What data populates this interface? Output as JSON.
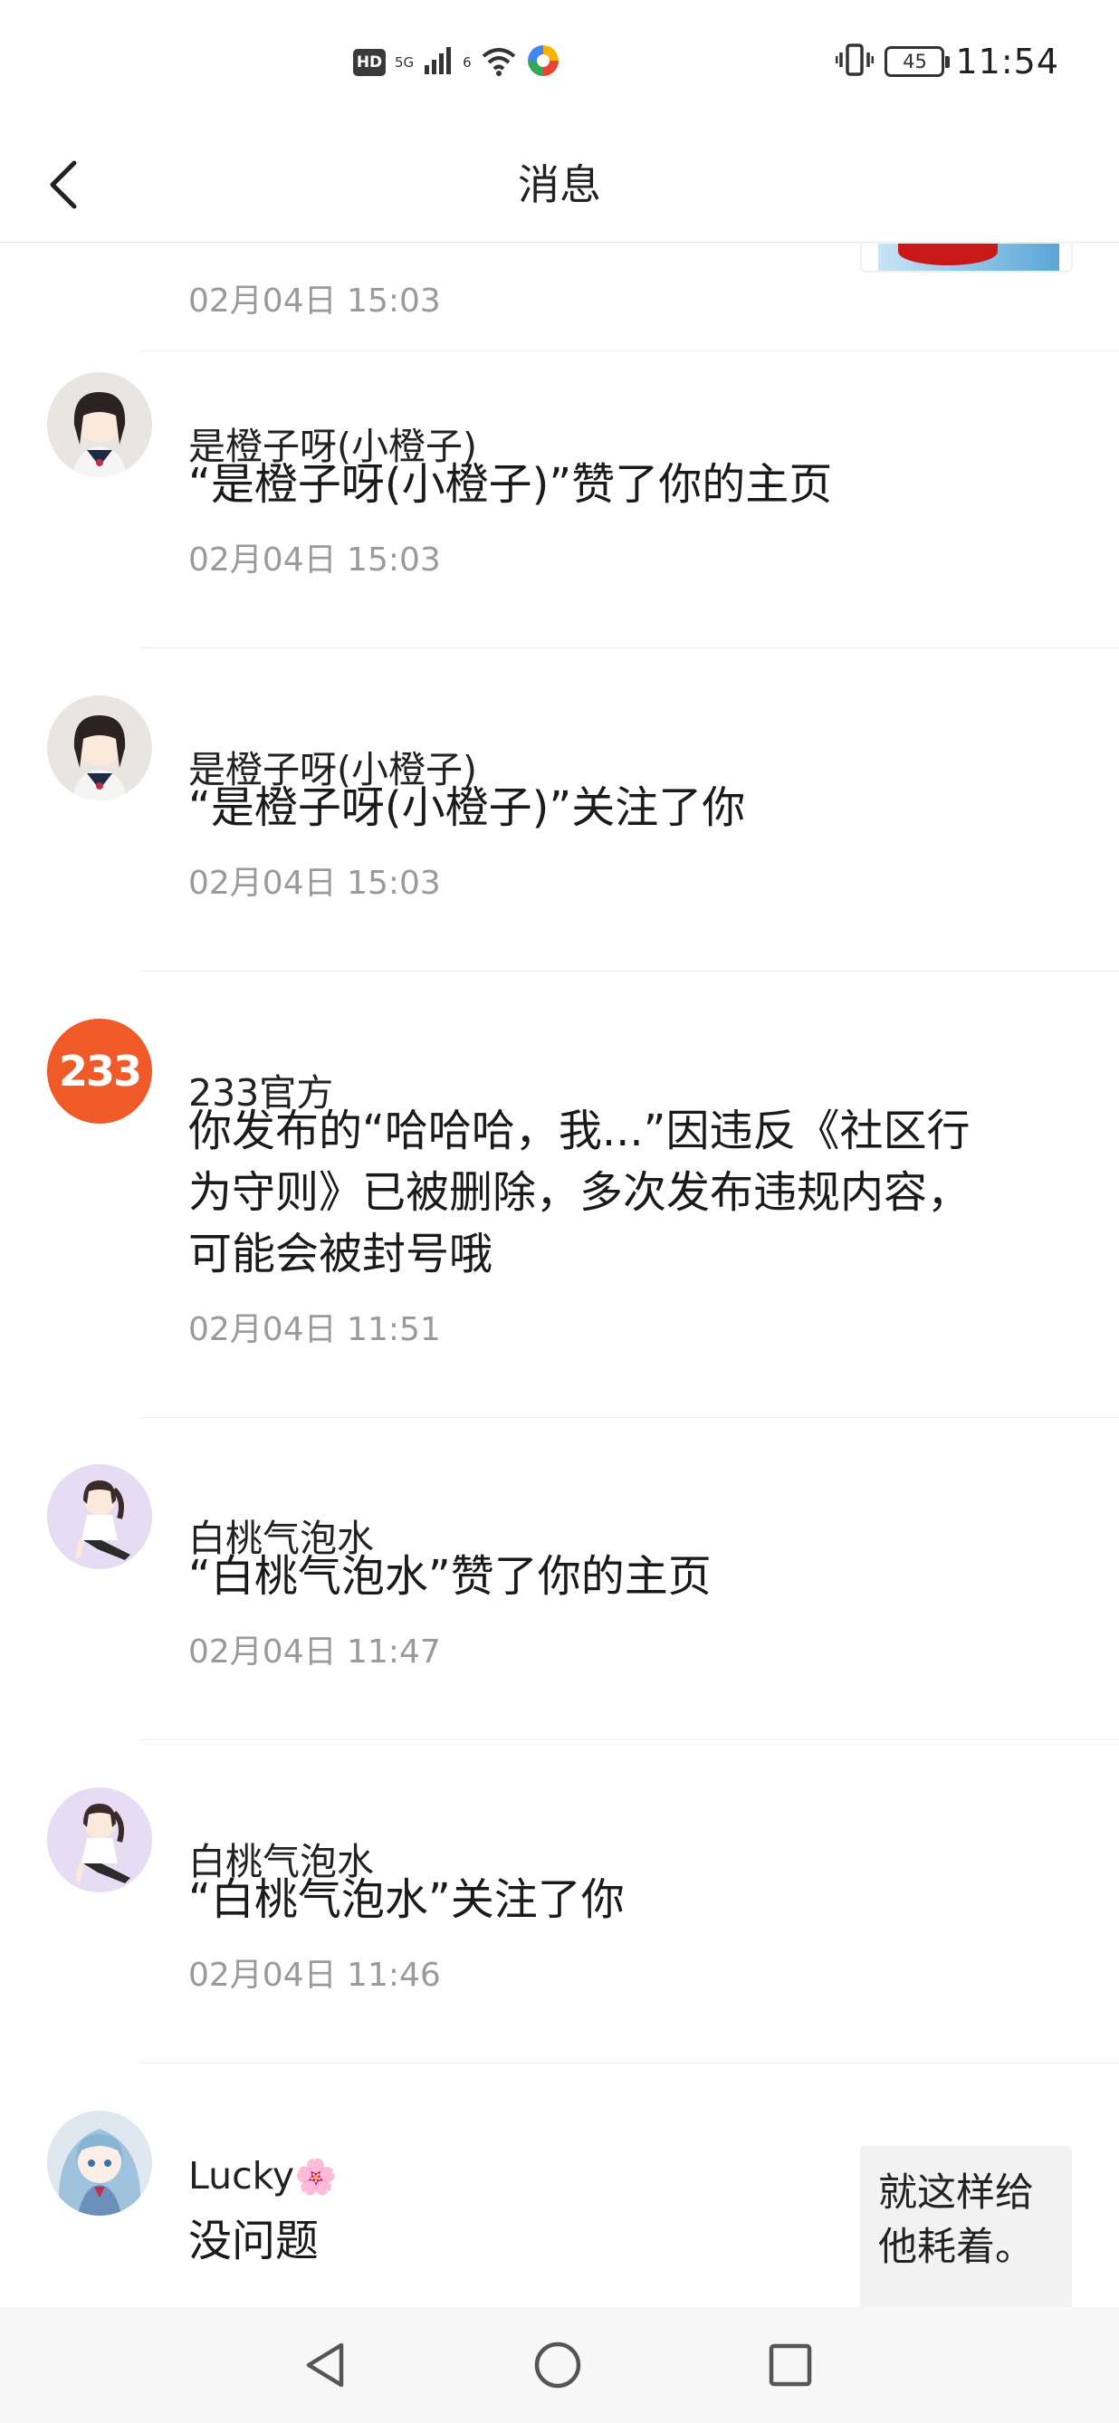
{
  "status_bar": {
    "hd": "HD",
    "net_5g": "5G",
    "net_6": "6",
    "battery": "45",
    "time": "11:54"
  },
  "header": {
    "title": "消息"
  },
  "messages": [
    {
      "time": "02月04日 15:03"
    },
    {
      "name": "是橙子呀(小橙子)",
      "content": "“是橙子呀(小橙子)”赞了你的主页",
      "time": "02月04日 15:03"
    },
    {
      "name": "是橙子呀(小橙子)",
      "content": "“是橙子呀(小橙子)”关注了你",
      "time": "02月04日 15:03"
    },
    {
      "name": "233官方",
      "avatar_text": "233",
      "content": "你发布的“哈哈哈，我...”因违反《社区行为守则》已被删除，多次发布违规内容，可能会被封号哦",
      "time": "02月04日 11:51"
    },
    {
      "name": "白桃气泡水",
      "content": "“白桃气泡水”赞了你的主页",
      "time": "02月04日 11:47"
    },
    {
      "name": "白桃气泡水",
      "content": "“白桃气泡水”关注了你",
      "time": "02月04日 11:46"
    },
    {
      "name": "Lucky",
      "name_emoji": "🌸",
      "content": "没问题",
      "reply_quote": "就这样给他耗着。"
    }
  ],
  "colors": {
    "official_avatar": "#f05a28",
    "time_gray": "#9a9a9a",
    "divider": "#ececec"
  }
}
